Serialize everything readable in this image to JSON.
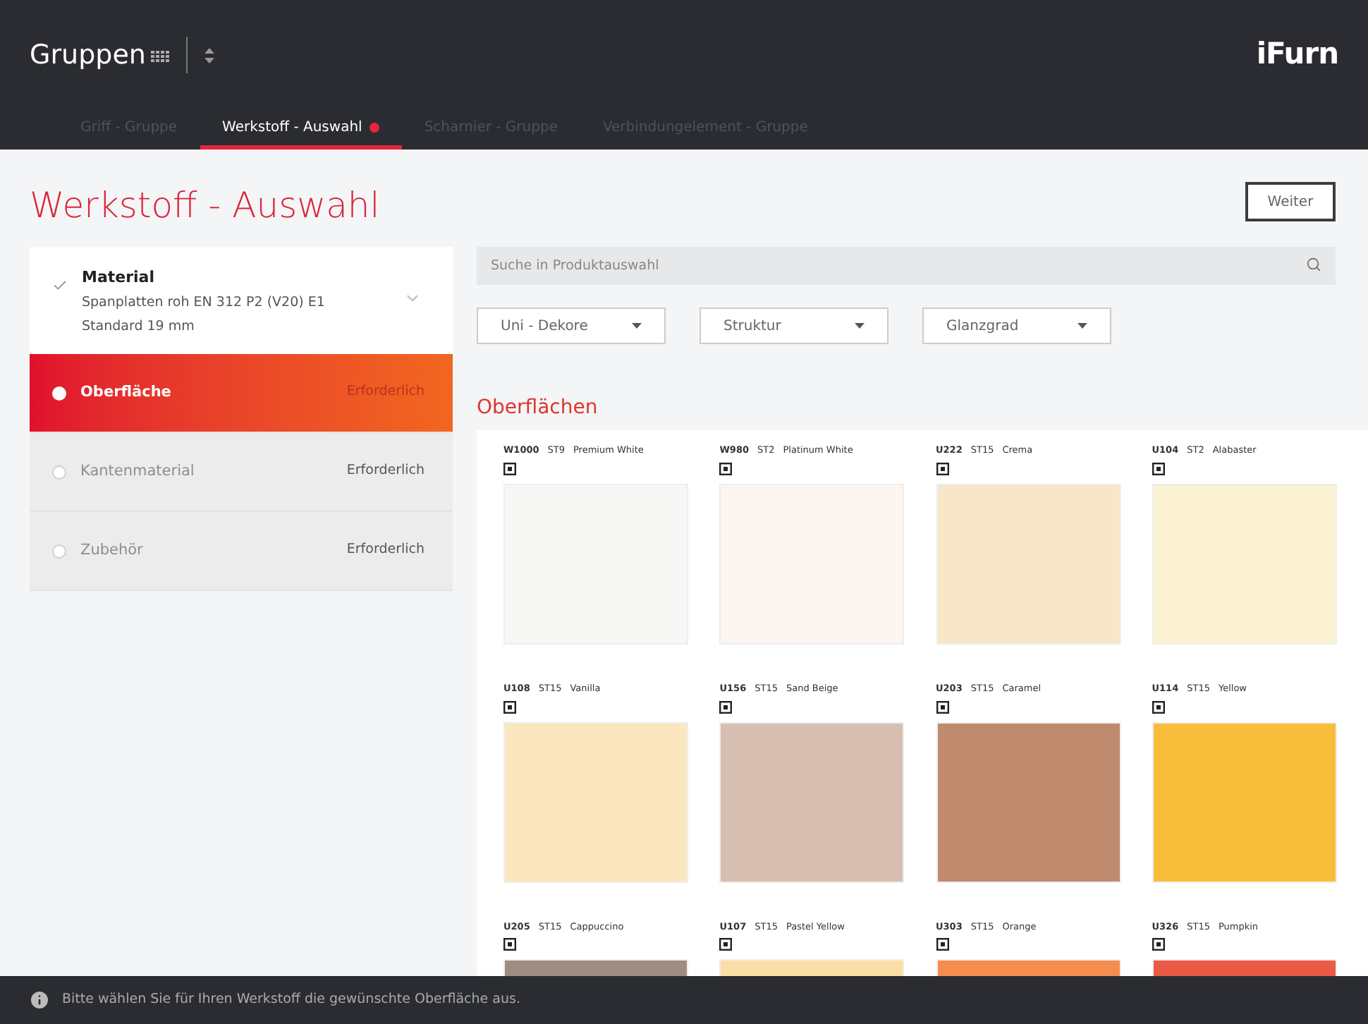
{
  "header": {
    "title": "Gruppen",
    "logo": "iFurn"
  },
  "tabs": [
    {
      "label": "Griff - Gruppe",
      "selected": false,
      "marked": false
    },
    {
      "label": "Werkstoff - Auswahl",
      "selected": true,
      "marked": true
    },
    {
      "label": "Scharnier - Gruppe",
      "selected": false,
      "marked": false
    },
    {
      "label": "Verbindungelement - Gruppe",
      "selected": false,
      "marked": false
    }
  ],
  "page_title": "Werkstoff - Auswahl",
  "next_button": "Weiter",
  "steps": [
    {
      "kind": "done",
      "title": "Material",
      "lines": [
        "Spanplatten roh EN 312 P2 (V20) E1",
        "Standard 19 mm"
      ]
    },
    {
      "kind": "active",
      "title": "Oberfläche",
      "note": "Erforderlich"
    },
    {
      "kind": "pending",
      "title": "Kantenmaterial",
      "note": "Erforderlich"
    },
    {
      "kind": "pending",
      "title": "Zubehör",
      "note": "Erforderlich"
    }
  ],
  "search": {
    "placeholder": "Suche in Produktauswahl"
  },
  "filters": [
    "Uni - Dekore",
    "Struktur",
    "Glanzgrad"
  ],
  "section_title": "Oberflächen",
  "swatches": [
    {
      "code": "W1000",
      "structure": "ST9",
      "name": "Premium White",
      "color": "#f7f7f6"
    },
    {
      "code": "W980",
      "structure": "ST2",
      "name": "Platinum White",
      "color": "#fcf5f0"
    },
    {
      "code": "U222",
      "structure": "ST15",
      "name": "Crema",
      "color": "#f8e6c8"
    },
    {
      "code": "U104",
      "structure": "ST2",
      "name": "Alabaster",
      "color": "#fbf1d3"
    },
    {
      "code": "U108",
      "structure": "ST15",
      "name": "Vanilla",
      "color": "#fbe7bf"
    },
    {
      "code": "U156",
      "structure": "ST15",
      "name": "Sand Beige",
      "color": "#d6bfb1"
    },
    {
      "code": "U203",
      "structure": "ST15",
      "name": "Caramel",
      "color": "#bf8a6e"
    },
    {
      "code": "U114",
      "structure": "ST15",
      "name": "Yellow",
      "color": "#f9bd3c"
    },
    {
      "code": "U205",
      "structure": "ST15",
      "name": "Cappuccino",
      "color": "#a08d82"
    },
    {
      "code": "U107",
      "structure": "ST15",
      "name": "Pastel Yellow",
      "color": "#fbdea5"
    },
    {
      "code": "U303",
      "structure": "ST15",
      "name": "Orange",
      "color": "#f58d4f"
    },
    {
      "code": "U326",
      "structure": "ST15",
      "name": "Pumpkin",
      "color": "#ea5a45"
    }
  ],
  "footer": "Bitte wählen Sie für Ihren Werkstoff die gewünschte Oberfläche aus."
}
